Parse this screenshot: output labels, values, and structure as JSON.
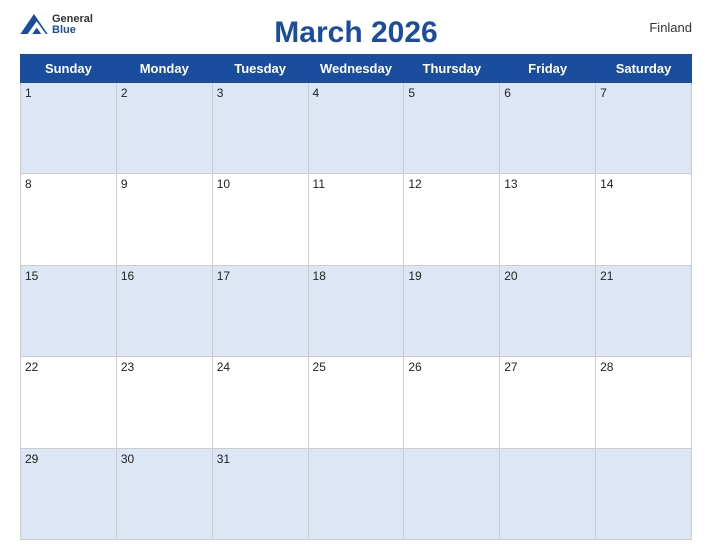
{
  "header": {
    "title": "March 2026",
    "country": "Finland",
    "logo": {
      "line1": "General",
      "line2": "Blue"
    }
  },
  "weekdays": [
    "Sunday",
    "Monday",
    "Tuesday",
    "Wednesday",
    "Thursday",
    "Friday",
    "Saturday"
  ],
  "weeks": [
    [
      {
        "day": "1",
        "active": true
      },
      {
        "day": "2",
        "active": true
      },
      {
        "day": "3",
        "active": true
      },
      {
        "day": "4",
        "active": true
      },
      {
        "day": "5",
        "active": true
      },
      {
        "day": "6",
        "active": true
      },
      {
        "day": "7",
        "active": true
      }
    ],
    [
      {
        "day": "8",
        "active": true
      },
      {
        "day": "9",
        "active": true
      },
      {
        "day": "10",
        "active": true
      },
      {
        "day": "11",
        "active": true
      },
      {
        "day": "12",
        "active": true
      },
      {
        "day": "13",
        "active": true
      },
      {
        "day": "14",
        "active": true
      }
    ],
    [
      {
        "day": "15",
        "active": true
      },
      {
        "day": "16",
        "active": true
      },
      {
        "day": "17",
        "active": true
      },
      {
        "day": "18",
        "active": true
      },
      {
        "day": "19",
        "active": true
      },
      {
        "day": "20",
        "active": true
      },
      {
        "day": "21",
        "active": true
      }
    ],
    [
      {
        "day": "22",
        "active": true
      },
      {
        "day": "23",
        "active": true
      },
      {
        "day": "24",
        "active": true
      },
      {
        "day": "25",
        "active": true
      },
      {
        "day": "26",
        "active": true
      },
      {
        "day": "27",
        "active": true
      },
      {
        "day": "28",
        "active": true
      }
    ],
    [
      {
        "day": "29",
        "active": true
      },
      {
        "day": "30",
        "active": true
      },
      {
        "day": "31",
        "active": true
      },
      {
        "day": "",
        "active": false
      },
      {
        "day": "",
        "active": false
      },
      {
        "day": "",
        "active": false
      },
      {
        "day": "",
        "active": false
      }
    ]
  ]
}
